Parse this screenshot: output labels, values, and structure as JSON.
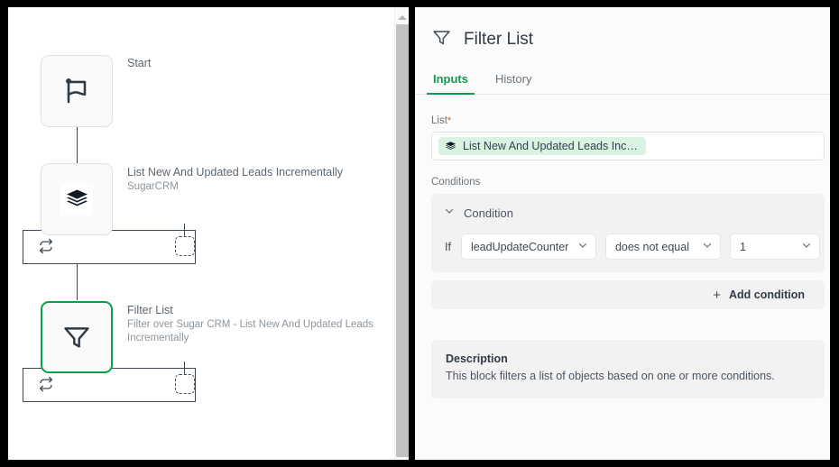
{
  "canvas": {
    "nodes": [
      {
        "id": "start",
        "title": "Start",
        "subtitle": "",
        "icon": "flag-icon",
        "selected": false
      },
      {
        "id": "list-leads",
        "title": "List New And Updated Leads Incrementally",
        "subtitle": "SugarCRM",
        "icon": "stack-icon",
        "selected": false
      },
      {
        "id": "filter-list",
        "title": "Filter List",
        "subtitle": "Filter over Sugar CRM - List New And Updated Leads Incrementally",
        "icon": "funnel-icon",
        "selected": true
      }
    ],
    "loop_icon": "loop-icon",
    "placeholder_icon": "dashed-placeholder-node",
    "scrollbar": {
      "up_arrow": "scroll-up-arrow-icon"
    }
  },
  "panel": {
    "icon": "funnel-icon",
    "title": "Filter List",
    "tabs": [
      {
        "label": "Inputs",
        "active": true
      },
      {
        "label": "History",
        "active": false
      }
    ],
    "list_field": {
      "label": "List",
      "required_marker": "*",
      "chip_icon": "stack-icon",
      "chip_text": "List New And Updated Leads Inc…"
    },
    "conditions": {
      "label": "Conditions",
      "card": {
        "caret_icon": "chevron-down-icon",
        "header": "Condition",
        "if_word": "If",
        "field_select": {
          "value": "leadUpdateCounter",
          "caret_icon": "chevron-down-icon"
        },
        "operator_select": {
          "value": "does not equal",
          "caret_icon": "chevron-down-icon"
        },
        "value_select": {
          "value": "1",
          "caret_icon": "chevron-down-icon"
        }
      },
      "add_condition": {
        "plus": "+",
        "label": "Add condition",
        "icon": "plus-icon"
      }
    },
    "description": {
      "title": "Description",
      "body": "This block filters a list of objects based on one or more conditions."
    }
  },
  "colors": {
    "accent_green": "#0f9d4f",
    "node_selected_border": "#0aa04a",
    "chip_bg": "#d9f2e2",
    "required_red": "#e4572e",
    "ink": "#3f4a54"
  }
}
